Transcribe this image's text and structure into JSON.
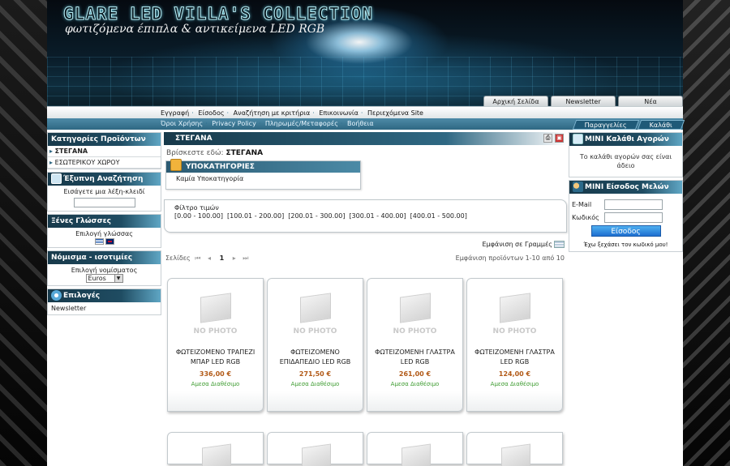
{
  "header": {
    "title": "GLARE LED VILLA'S COLLECTION",
    "subtitle": "φωτιζόμενα έπιπλα & αντικείμενα LED RGB",
    "tabs": [
      "Αρχική Σελίδα",
      "Newsletter",
      "Νέα"
    ]
  },
  "nav1": [
    "Εγγραφή",
    "Είσοδος",
    "Αναζήτηση με κριτήρια",
    "Επικοινωνία",
    "Περιεχόμενα Site"
  ],
  "nav2": {
    "links": [
      "Όροι Χρήσης",
      "Privacy Policy",
      "Πληρωμές/Μεταφορές",
      "Βοήθεια"
    ],
    "right_tabs": [
      "Παραγγελίες",
      "Καλάθι"
    ]
  },
  "left": {
    "categories_title": "Κατηγορίες Προϊόντων",
    "categories": [
      "ΣΤΕΓΑΝΑ",
      "ΕΣΩΤΕΡΙΚΟΥ ΧΩΡΟΥ"
    ],
    "search_title": "Έξυπνη Αναζήτηση",
    "search_hint": "Εισάγετε μια λέξη-κλειδί",
    "languages_title": "Ξένες Γλώσσες",
    "languages_hint": "Επιλογή γλώσσας",
    "currency_title": "Νόμισμα - ισοτιμίες",
    "currency_hint": "Επιλογή νομίσματος",
    "currency_value": "Euros",
    "options_title": "Επιλογές",
    "options_item": "Newsletter"
  },
  "center": {
    "heading": "ΣΤΕΓΑΝΑ",
    "breadcrumb_prefix": "Βρίσκεστε εδώ:",
    "breadcrumb_current": "ΣΤΕΓΑΝΑ",
    "subcats_title": "ΥΠΟΚΑΤΗΓΟΡΙΕΣ",
    "subcats_body": "Καμία Υποκατηγορία",
    "filter_label": "Φίλτρο τιμών",
    "price_ranges": [
      "[0.00 - 100.00]",
      "[100.01 - 200.00]",
      "[200.01 - 300.00]",
      "[300.01 - 400.00]",
      "[400.01 - 500.00]"
    ],
    "view_mode": "Εμφάνιση σε Γραμμές",
    "pages_label": "Σελίδες",
    "current_page": "1",
    "showing": "Εμφάνιση προϊόντων 1-10 από 10",
    "no_photo": "NO PHOTO",
    "products": [
      {
        "name": "ΦΩΤΕΙΖΟΜΕΝΟ ΤΡΑΠΕΖΙ ΜΠΑΡ LED RGB",
        "price": "336,00 €",
        "stock": "Αμεσα Διαθέσιμο"
      },
      {
        "name": "ΦΩΤΕΙΖΟΜΕΝΟ ΕΠΙΔΑΠΕΔΙΟ LED RGB",
        "price": "271,50 €",
        "stock": "Αμεσα Διαθέσιμο"
      },
      {
        "name": "ΦΩΤΕΙΖΟΜΕΝΗ ΓΛΑΣΤΡΑ LED RGB",
        "price": "261,00 €",
        "stock": "Αμεσα Διαθέσιμο"
      },
      {
        "name": "ΦΩΤΕΙΖΟΜΕΝΗ ΓΛΑΣΤΡΑ LED RGB",
        "price": "124,00 €",
        "stock": "Αμεσα Διαθέσιμο"
      }
    ]
  },
  "right": {
    "cart_title": "MINI Καλάθι Αγορών",
    "cart_empty": "Το καλάθι αγορών σας είναι άδειο",
    "login_title": "MINI Είσοδος Μελών",
    "email_label": "E-Mail",
    "password_label": "Κωδικός",
    "login_button": "Είσοδος",
    "forgot": "Έχω ξεχάσει τον κωδικό μου!"
  },
  "colors": {
    "accent": "#2f6883",
    "price": "#b25a17",
    "stock": "#3e9c31"
  }
}
